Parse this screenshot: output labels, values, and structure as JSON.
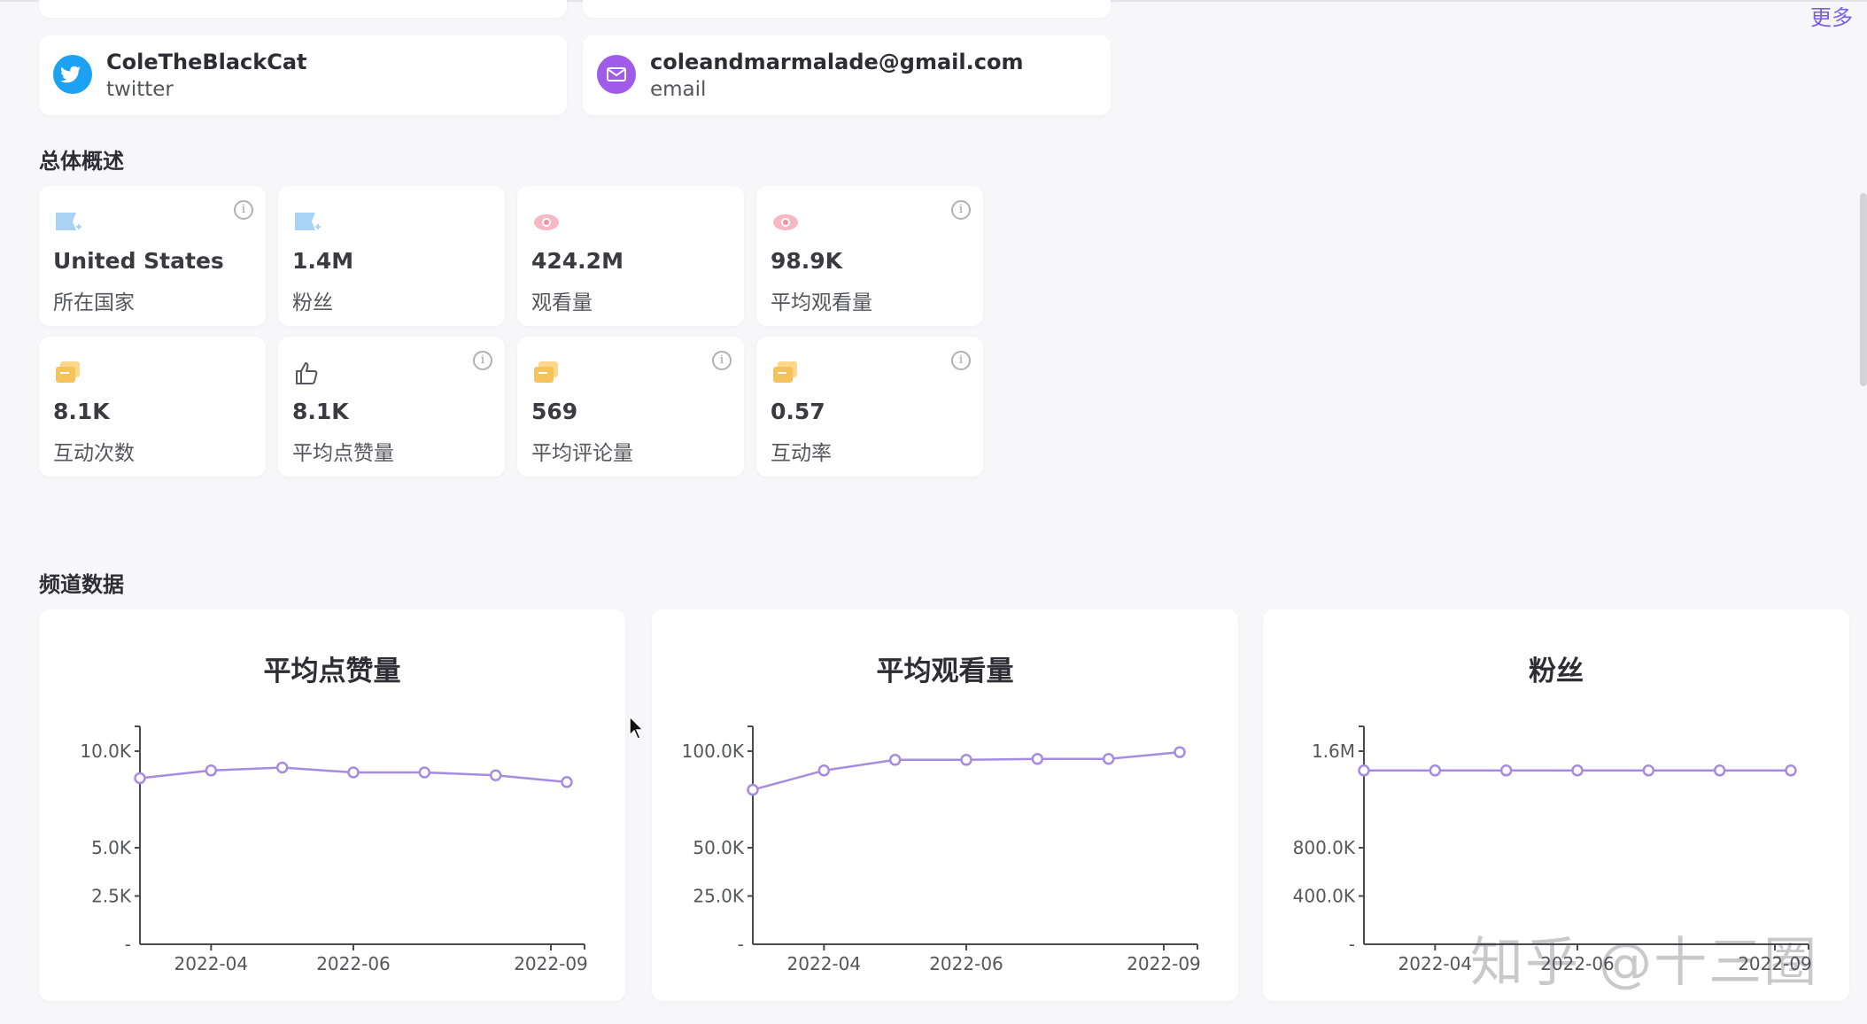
{
  "header": {
    "more_label": "更多"
  },
  "contacts": [
    {
      "name": "ColeTheBlackCat",
      "type": "twitter",
      "icon": "twitter-icon",
      "color": "#1da1f2"
    },
    {
      "name": "coleandmarmalade@gmail.com",
      "type": "email",
      "icon": "email-icon",
      "color": "#a05be8"
    }
  ],
  "overview": {
    "title": "总体概述",
    "stats": [
      {
        "value": "United States",
        "label": "所在国家",
        "icon": "flag-icon",
        "info": true
      },
      {
        "value": "1.4M",
        "label": "粉丝",
        "icon": "flag-icon",
        "info": false
      },
      {
        "value": "424.2M",
        "label": "观看量",
        "icon": "eye-icon",
        "info": false
      },
      {
        "value": "98.9K",
        "label": "平均观看量",
        "icon": "eye-icon",
        "info": true
      },
      {
        "value": "8.1K",
        "label": "互动次数",
        "icon": "chat-icon",
        "info": false
      },
      {
        "value": "8.1K",
        "label": "平均点赞量",
        "icon": "thumbs-up-icon",
        "info": true
      },
      {
        "value": "569",
        "label": "平均评论量",
        "icon": "chat-icon",
        "info": true
      },
      {
        "value": "0.57",
        "label": "互动率",
        "icon": "chat-icon",
        "info": true
      }
    ]
  },
  "channel": {
    "title": "频道数据"
  },
  "chart_data": [
    {
      "type": "line",
      "title": "平均点赞量",
      "x_ticks": [
        "2022-04",
        "2022-06",
        "2022-09"
      ],
      "y_ticks": [
        "10.0K",
        "5.0K",
        "2.5K",
        "-"
      ],
      "y_tick_values": [
        10000,
        5000,
        2500,
        0
      ],
      "ylim": [
        0,
        10000
      ],
      "series": [
        {
          "values": [
            8600,
            9000,
            9150,
            8900,
            8900,
            8750,
            8400
          ]
        }
      ],
      "color": "#a78be0"
    },
    {
      "type": "line",
      "title": "平均观看量",
      "x_ticks": [
        "2022-04",
        "2022-06",
        "2022-09"
      ],
      "y_ticks": [
        "100.0K",
        "50.0K",
        "25.0K",
        "-"
      ],
      "y_tick_values": [
        100000,
        50000,
        25000,
        0
      ],
      "ylim": [
        0,
        100000
      ],
      "series": [
        {
          "values": [
            80000,
            90000,
            95500,
            95500,
            96000,
            96000,
            99500
          ]
        }
      ],
      "color": "#a78be0"
    },
    {
      "type": "line",
      "title": "粉丝",
      "x_ticks": [
        "2022-04",
        "2022-06",
        "2022-09"
      ],
      "y_ticks": [
        "1.6M",
        "800.0K",
        "400.0K",
        "-"
      ],
      "y_tick_values": [
        1600000,
        800000,
        400000,
        0
      ],
      "ylim": [
        0,
        1600000
      ],
      "series": [
        {
          "values": [
            1440000,
            1440000,
            1440000,
            1440000,
            1440000,
            1440000,
            1440000
          ]
        }
      ],
      "color": "#a78be0"
    }
  ],
  "watermark": "知乎 @十三圈"
}
